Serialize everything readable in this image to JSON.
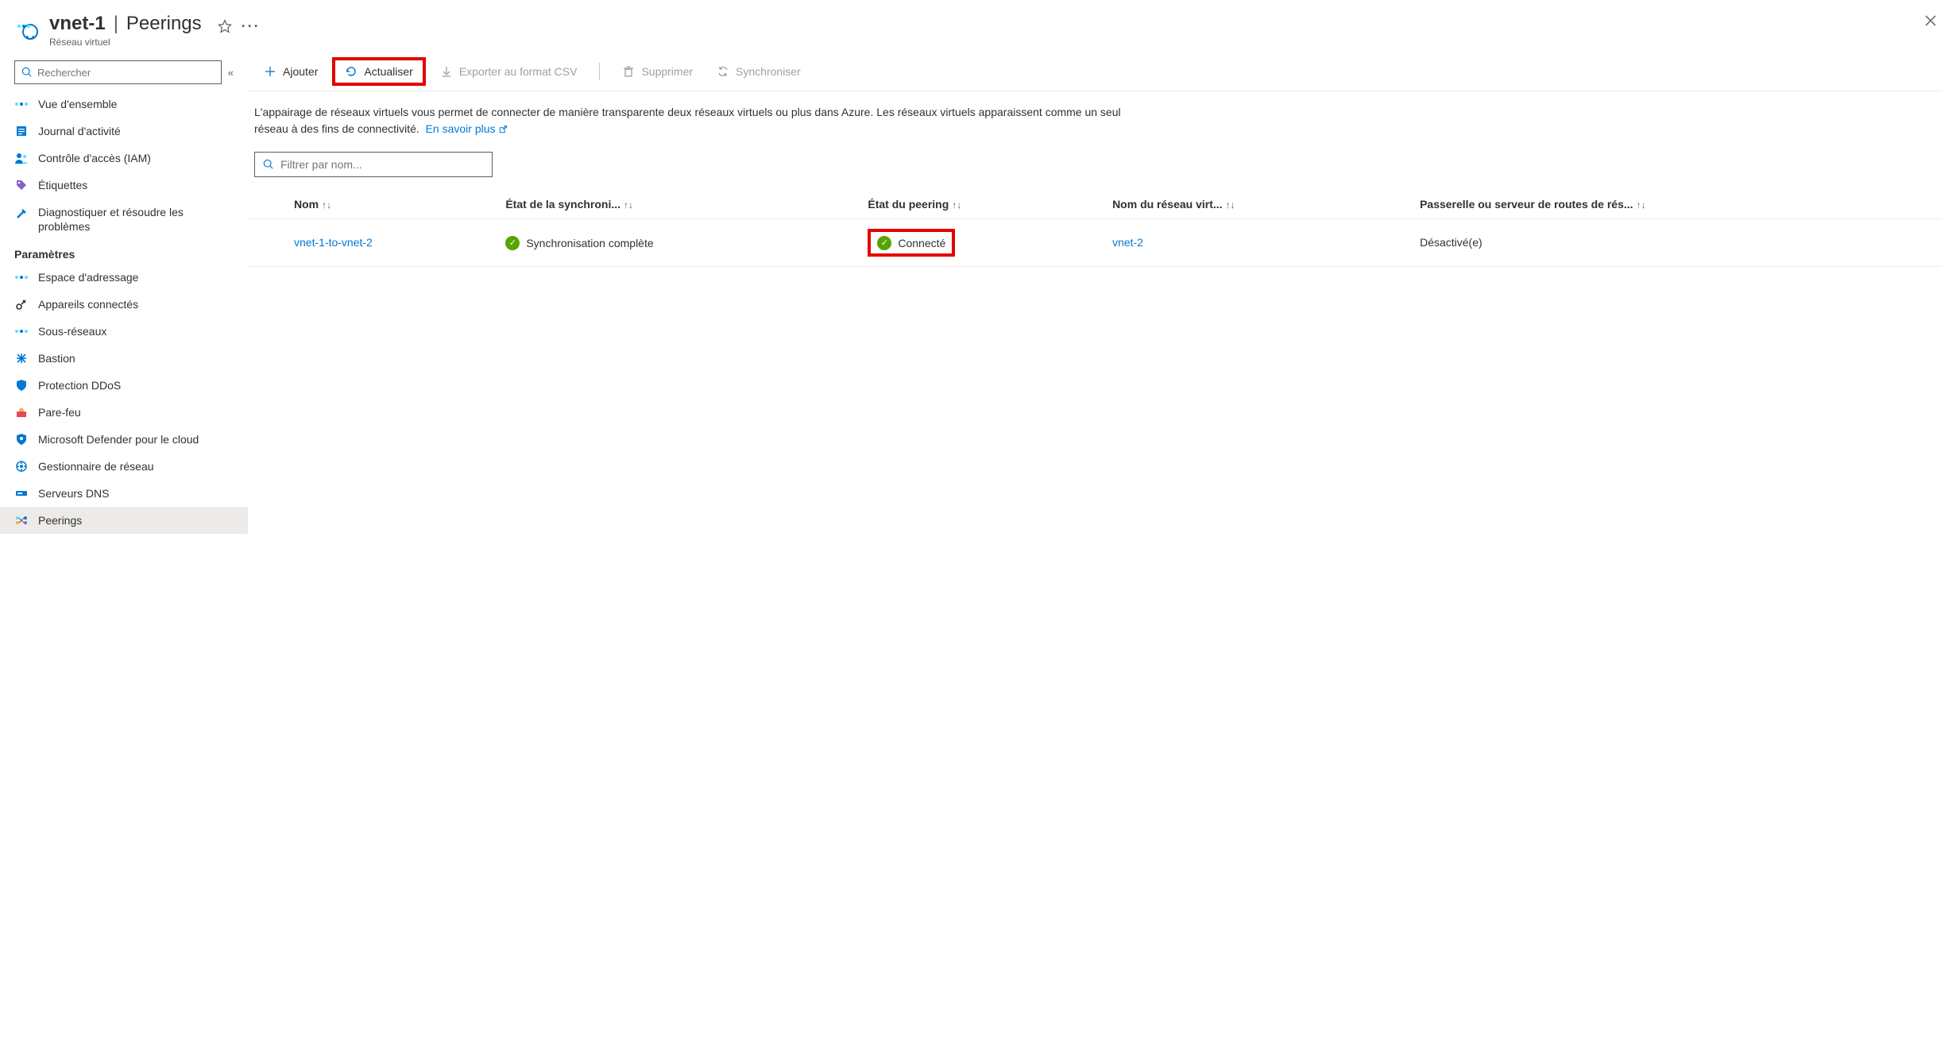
{
  "header": {
    "title": "vnet-1",
    "section": "Peerings",
    "subtitle": "Réseau virtuel"
  },
  "sidebar": {
    "search_placeholder": "Rechercher",
    "items": [
      {
        "label": "Vue d'ensemble"
      },
      {
        "label": "Journal d'activité"
      },
      {
        "label": "Contrôle d'accès (IAM)"
      },
      {
        "label": "Étiquettes"
      },
      {
        "label": "Diagnostiquer et résoudre les problèmes"
      }
    ],
    "section_label": "Paramètres",
    "settings": [
      {
        "label": "Espace d'adressage"
      },
      {
        "label": "Appareils connectés"
      },
      {
        "label": "Sous-réseaux"
      },
      {
        "label": "Bastion"
      },
      {
        "label": "Protection DDoS"
      },
      {
        "label": "Pare-feu"
      },
      {
        "label": "Microsoft Defender pour le cloud"
      },
      {
        "label": "Gestionnaire de réseau"
      },
      {
        "label": "Serveurs DNS"
      },
      {
        "label": "Peerings"
      }
    ]
  },
  "toolbar": {
    "add": "Ajouter",
    "refresh": "Actualiser",
    "export": "Exporter au format CSV",
    "delete": "Supprimer",
    "sync": "Synchroniser"
  },
  "description": {
    "text": "L'appairage de réseaux virtuels vous permet de connecter de manière transparente deux réseaux virtuels ou plus dans Azure. Les réseaux virtuels apparaissent comme un seul réseau à des fins de connectivité.",
    "link": "En savoir plus"
  },
  "filter": {
    "placeholder": "Filtrer par nom..."
  },
  "table": {
    "headers": {
      "name": "Nom",
      "sync": "État de la synchroni...",
      "peering": "État du peering",
      "vnet": "Nom du réseau virt...",
      "gateway": "Passerelle ou serveur de routes de rés..."
    },
    "rows": [
      {
        "name": "vnet-1-to-vnet-2",
        "sync": "Synchronisation complète",
        "peering": "Connecté",
        "vnet": "vnet-2",
        "gateway": "Désactivé(e)"
      }
    ]
  }
}
